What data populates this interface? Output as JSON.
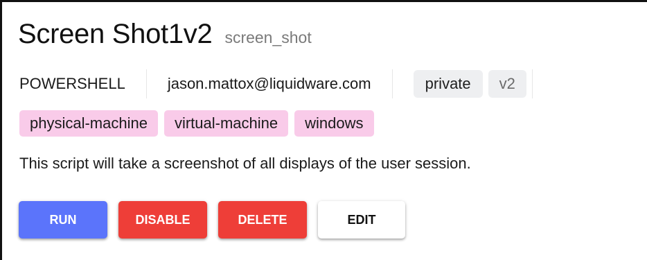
{
  "script": {
    "title": "Screen Shot1v2",
    "slug": "screen_shot",
    "language": "POWERSHELL",
    "author": "jason.mattox@liquidware.com",
    "visibility": "private",
    "version": "v2",
    "tags": [
      "physical-machine",
      "virtual-machine",
      "windows"
    ],
    "description": "This script will take a screenshot of all displays of the user session."
  },
  "actions": {
    "run_label": "RUN",
    "disable_label": "DISABLE",
    "delete_label": "DELETE",
    "edit_label": "EDIT"
  },
  "colors": {
    "run": "#5b74fb",
    "danger": "#ee3e38",
    "tag_bg": "#f9cbe9",
    "chip_bg": "#eeeff1"
  }
}
